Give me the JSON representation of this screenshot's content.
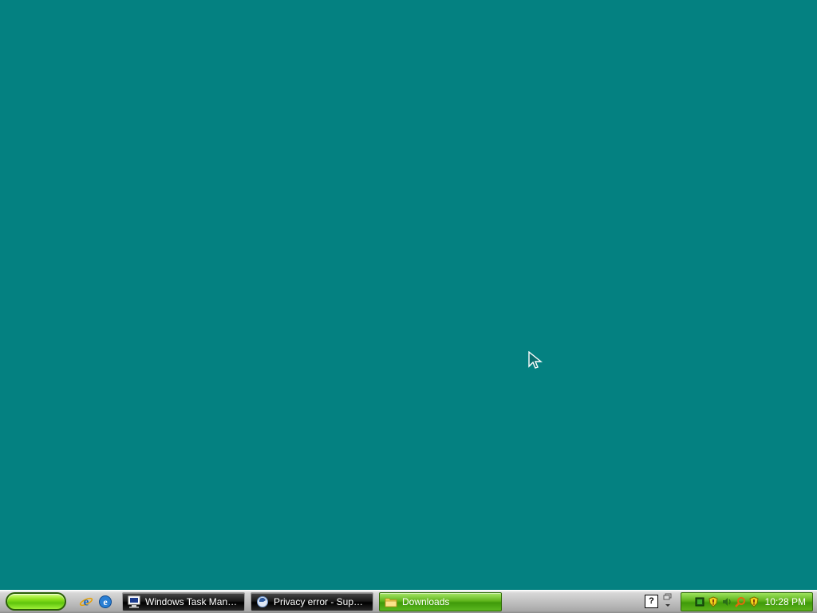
{
  "desktop": {
    "background_color": "#048181"
  },
  "taskbar": {
    "quick_launch": [
      {
        "icon": "internet-explorer-icon"
      },
      {
        "icon": "outlook-express-icon"
      }
    ],
    "tasks": [
      {
        "label": "Windows Task Mana...",
        "icon": "task-manager-icon",
        "active": false
      },
      {
        "label": "Privacy error - Super...",
        "icon": "browser-icon",
        "active": false
      },
      {
        "label": "Downloads",
        "icon": "folder-icon",
        "active": true
      }
    ],
    "tray": {
      "icons": [
        "network-icon",
        "security-shield-icon",
        "volume-icon",
        "search-icon",
        "security-shield-icon"
      ],
      "clock": "10:28 PM"
    }
  }
}
